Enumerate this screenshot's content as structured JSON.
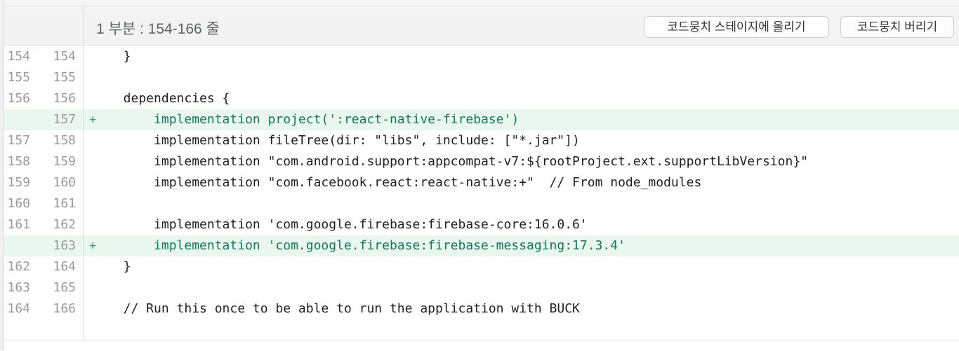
{
  "hunk": {
    "title": "1 부분 : 154-166 줄",
    "stage_button": "코드뭉치 스테이지에 올리기",
    "discard_button": "코드뭉치 버리기"
  },
  "lines": [
    {
      "old": "154",
      "new": "154",
      "sign": "",
      "type": "context",
      "text": "  }"
    },
    {
      "old": "155",
      "new": "155",
      "sign": "",
      "type": "context",
      "text": ""
    },
    {
      "old": "156",
      "new": "156",
      "sign": "",
      "type": "context",
      "text": "  dependencies {"
    },
    {
      "old": "",
      "new": "157",
      "sign": "+",
      "type": "added",
      "text": "      implementation project(':react-native-firebase')"
    },
    {
      "old": "157",
      "new": "158",
      "sign": "",
      "type": "context",
      "text": "      implementation fileTree(dir: \"libs\", include: [\"*.jar\"])"
    },
    {
      "old": "158",
      "new": "159",
      "sign": "",
      "type": "context",
      "text": "      implementation \"com.android.support:appcompat-v7:${rootProject.ext.supportLibVersion}\""
    },
    {
      "old": "159",
      "new": "160",
      "sign": "",
      "type": "context",
      "text": "      implementation \"com.facebook.react:react-native:+\"  // From node_modules"
    },
    {
      "old": "160",
      "new": "161",
      "sign": "",
      "type": "context",
      "text": ""
    },
    {
      "old": "161",
      "new": "162",
      "sign": "",
      "type": "context",
      "text": "      implementation 'com.google.firebase:firebase-core:16.0.6'"
    },
    {
      "old": "",
      "new": "163",
      "sign": "+",
      "type": "added",
      "text": "      implementation 'com.google.firebase:firebase-messaging:17.3.4'"
    },
    {
      "old": "162",
      "new": "164",
      "sign": "",
      "type": "context",
      "text": "  }"
    },
    {
      "old": "163",
      "new": "165",
      "sign": "",
      "type": "context",
      "text": ""
    },
    {
      "old": "164",
      "new": "166",
      "sign": "",
      "type": "context",
      "text": "  // Run this once to be able to run the application with BUCK"
    }
  ],
  "colors": {
    "added_background": "#e9f7ef",
    "added_text": "#0f7a5c",
    "added_sign": "#2aa36b"
  }
}
